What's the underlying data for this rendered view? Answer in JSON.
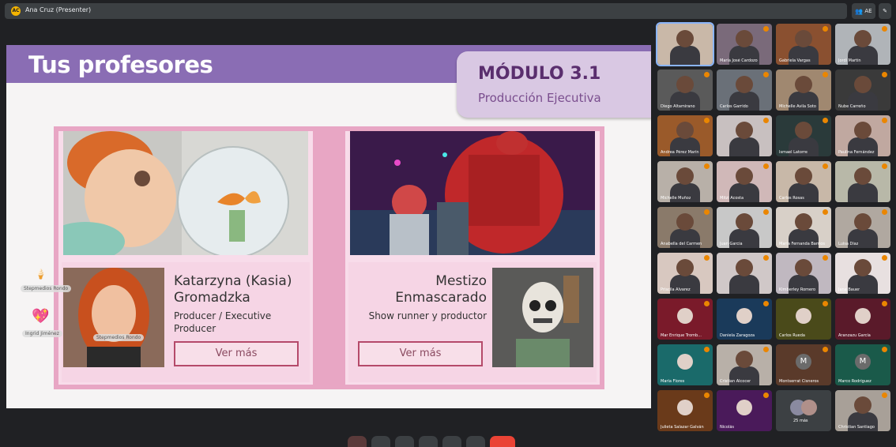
{
  "meeting": {
    "presenter_label": "Ana Cruz (Presenter)",
    "presenter_initials": "AC",
    "view_count": "AE"
  },
  "slide": {
    "title": "Tus profesores",
    "module_title": "MÓDULO 3.1",
    "module_subtitle": "Producción Ejecutiva",
    "teachers": [
      {
        "name": "Katarzyna (Kasia) Gromadzka",
        "role": "Producer / Executive Producer",
        "button": "Ver más",
        "portrait_caption": "Stepmedios Rondo"
      },
      {
        "name": "Mestizo Enmascarado",
        "role": "Show runner y productor",
        "button": "Ver más"
      }
    ]
  },
  "reactions": [
    {
      "emoji": "🍦",
      "name": "Stepmedios Rondo"
    },
    {
      "emoji": "💖",
      "name": "Ingrid Jiménez"
    }
  ],
  "participants": [
    {
      "name": "",
      "color": "#c9b8a8",
      "kind": "video"
    },
    {
      "name": "María José Cardozo",
      "color": "#7a6a7a",
      "kind": "video"
    },
    {
      "name": "Gabriela Vargas",
      "color": "#8a5030",
      "kind": "video"
    },
    {
      "name": "Jordi Martín",
      "color": "#b0b4b8",
      "kind": "video"
    },
    {
      "name": "Diego Altamirano",
      "color": "#5a5a5a",
      "kind": "video"
    },
    {
      "name": "Carlos Garrido",
      "color": "#6a7078",
      "kind": "video"
    },
    {
      "name": "Michelle Avila Soto",
      "color": "#a08870",
      "kind": "video"
    },
    {
      "name": "Nube Carreño",
      "color": "#3a3a3a",
      "kind": "video"
    },
    {
      "name": "Andrea Pérez Marín",
      "color": "#9a5a2a",
      "kind": "video"
    },
    {
      "name": "",
      "color": "#c8c0c0",
      "kind": "video"
    },
    {
      "name": "Ismael Latorre",
      "color": "#2a3a3a",
      "kind": "video"
    },
    {
      "name": "Paulina Fernández",
      "color": "#c0a8a0",
      "kind": "video"
    },
    {
      "name": "Michelle Muñoz",
      "color": "#b8b0a8",
      "kind": "video"
    },
    {
      "name": "Mitzi Acosta",
      "color": "#d0b8b8",
      "kind": "video"
    },
    {
      "name": "Carlos Rosas",
      "color": "#c8b8a8",
      "kind": "video"
    },
    {
      "name": "",
      "color": "#b8b8a8",
      "kind": "video"
    },
    {
      "name": "Anabella del Carmen",
      "color": "#8a7a6a",
      "kind": "video"
    },
    {
      "name": "Juan García",
      "color": "#c8c8c8",
      "kind": "video"
    },
    {
      "name": "María Fernanda Barrios",
      "color": "#d8d0c8",
      "kind": "video"
    },
    {
      "name": "Luisa Díaz",
      "color": "#b0a8a0",
      "kind": "video"
    },
    {
      "name": "Priscila Álvarez",
      "color": "#d8c8c0",
      "kind": "video"
    },
    {
      "name": "",
      "color": "#d0c8c8",
      "kind": "video"
    },
    {
      "name": "Kimberley Romero",
      "color": "#c0b8c0",
      "kind": "video"
    },
    {
      "name": "Jane Bauer",
      "color": "#e8e0e0",
      "kind": "video"
    },
    {
      "name": "Mar Enrique Tromb...",
      "color": "#7a1a2a",
      "kind": "avatar"
    },
    {
      "name": "Daniela Zaragoza",
      "color": "#1a3a5a",
      "kind": "avatar"
    },
    {
      "name": "Carlos Rueda",
      "color": "#4a4a1a",
      "kind": "avatar"
    },
    {
      "name": "Aranzazu García",
      "color": "#5a1a2a",
      "kind": "avatar"
    },
    {
      "name": "María Flores",
      "color": "#1a6a6a",
      "kind": "avatar"
    },
    {
      "name": "Cristian Alcocer",
      "color": "#b8b0a8",
      "kind": "video"
    },
    {
      "name": "Montserrat Cisneros",
      "color": "#5a3a2a",
      "kind": "letter",
      "letter": "M"
    },
    {
      "name": "Marco Rodríguez",
      "color": "#1a5a4a",
      "kind": "letter",
      "letter": "M"
    },
    {
      "name": "Julieta Salazar Galván",
      "color": "#6a3a1a",
      "kind": "avatar"
    },
    {
      "name": "Nicolás",
      "color": "#4a1a5a",
      "kind": "avatar"
    },
    {
      "name": "25 más",
      "color": "#3c4043",
      "kind": "more"
    },
    {
      "name": "Christian Santiago",
      "color": "#a8a098",
      "kind": "video"
    }
  ]
}
